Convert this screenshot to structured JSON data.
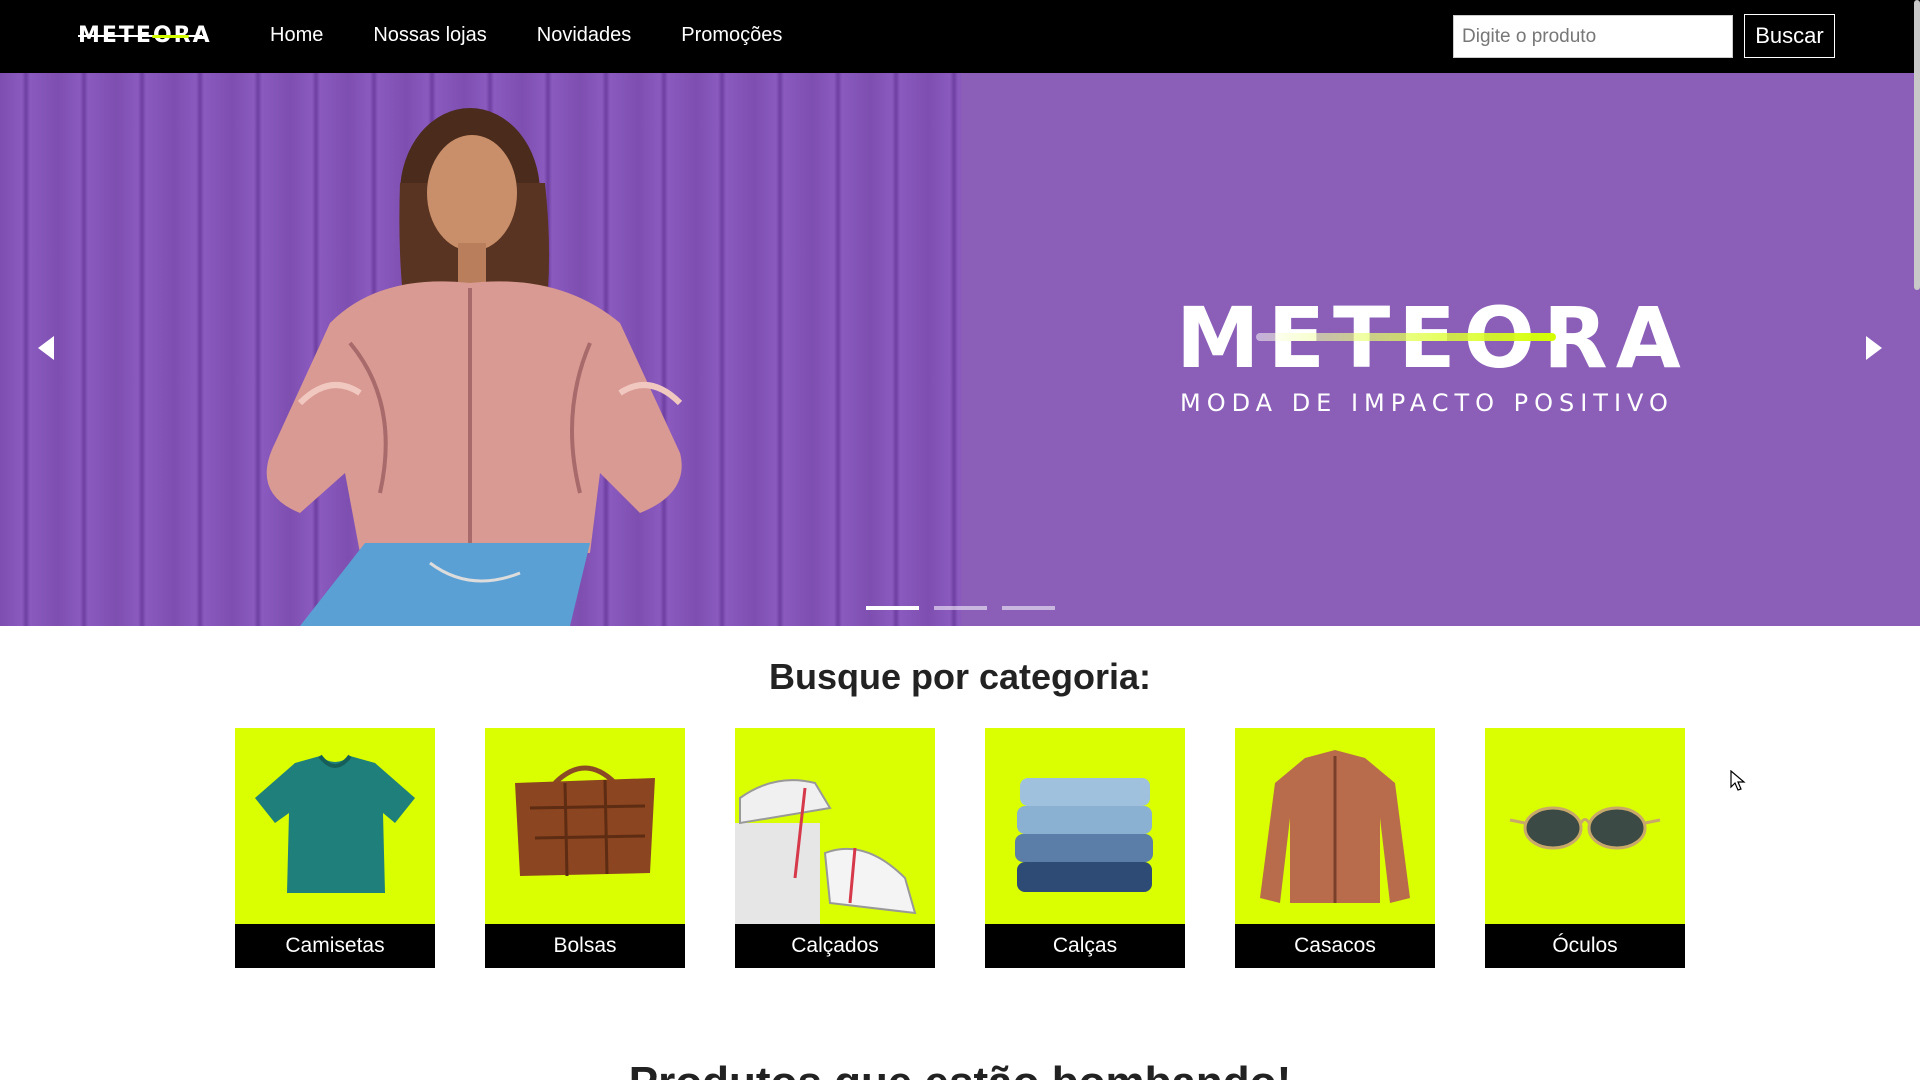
{
  "header": {
    "logo": "METEORA",
    "nav": [
      "Home",
      "Nossas lojas",
      "Novidades",
      "Promoções"
    ],
    "search_placeholder": "Digite o produto",
    "search_button": "Buscar"
  },
  "hero": {
    "brand": "METEORA",
    "tagline": "MODA DE IMPACTO POSITIVO",
    "slide_count": 3,
    "active_slide": 1
  },
  "categories": {
    "title": "Busque por categoria:",
    "items": [
      "Camisetas",
      "Bolsas",
      "Calçados",
      "Calças",
      "Casacos",
      "Óculos"
    ]
  },
  "next_section": {
    "title": "Produtos que estão bombando!"
  },
  "colors": {
    "accent": "#d9ff00",
    "hero_bg": "#8b5fb8",
    "header_bg": "#000000"
  }
}
